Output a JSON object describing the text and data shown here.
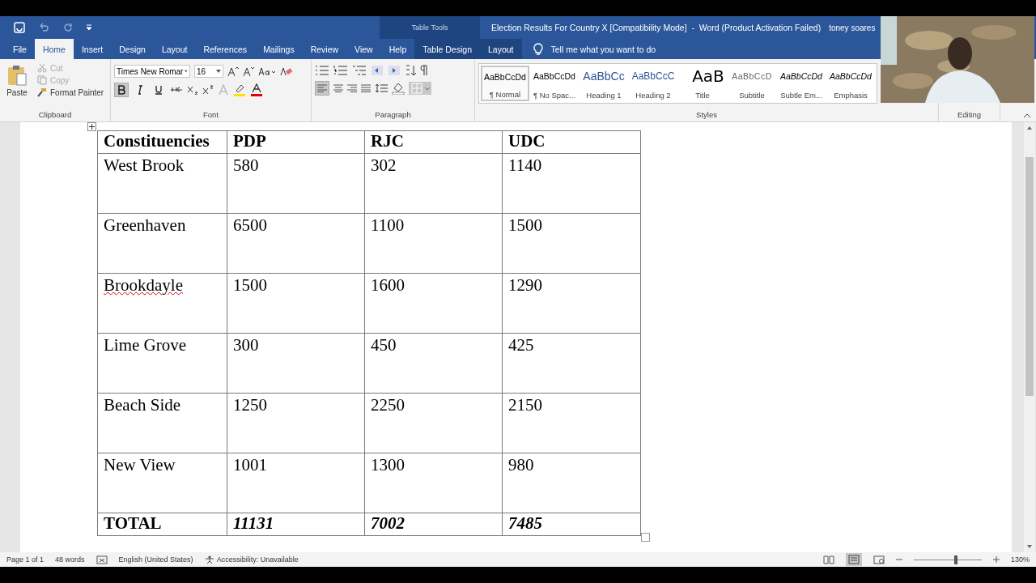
{
  "title_bar": {
    "context_label": "Table Tools",
    "title": "Election Results For Country X [Compatibility Mode]  -  Word (Product Activation Failed)",
    "user": "toney soares"
  },
  "tabs": [
    {
      "label": "File",
      "selected": false,
      "kind": "main"
    },
    {
      "label": "Home",
      "selected": true,
      "kind": "main"
    },
    {
      "label": "Insert",
      "selected": false,
      "kind": "main"
    },
    {
      "label": "Design",
      "selected": false,
      "kind": "main"
    },
    {
      "label": "Layout",
      "selected": false,
      "kind": "main"
    },
    {
      "label": "References",
      "selected": false,
      "kind": "main"
    },
    {
      "label": "Mailings",
      "selected": false,
      "kind": "main"
    },
    {
      "label": "Review",
      "selected": false,
      "kind": "main"
    },
    {
      "label": "View",
      "selected": false,
      "kind": "main"
    },
    {
      "label": "Help",
      "selected": false,
      "kind": "main"
    },
    {
      "label": "Table Design",
      "selected": false,
      "kind": "context"
    },
    {
      "label": "Layout",
      "selected": false,
      "kind": "context"
    }
  ],
  "tell_me": "Tell me what you want to do",
  "clipboard": {
    "label": "Clipboard",
    "paste": "Paste",
    "cut": {
      "label": "Cut",
      "disabled": true
    },
    "copy": {
      "label": "Copy",
      "disabled": true
    },
    "format_painter": "Format Painter"
  },
  "font": {
    "label": "Font",
    "name": "Times New Romar",
    "size": "16",
    "bold": true,
    "italic": false,
    "underline": false
  },
  "paragraph": {
    "label": "Paragraph",
    "align_left": true
  },
  "styles": {
    "label": "Styles",
    "items": [
      {
        "preview": "AaBbCcDd",
        "name": "¶ Normal",
        "selected": true,
        "kind": "normal"
      },
      {
        "preview": "AaBbCcDd",
        "name": "¶ No Spac...",
        "selected": false,
        "kind": "normal"
      },
      {
        "preview": "AaBbCc",
        "name": "Heading 1",
        "selected": false,
        "kind": "heading1"
      },
      {
        "preview": "AaBbCcC",
        "name": "Heading 2",
        "selected": false,
        "kind": "heading2"
      },
      {
        "preview": "AaB",
        "name": "Title",
        "selected": false,
        "kind": "title"
      },
      {
        "preview": "AaBbCcD",
        "name": "Subtitle",
        "selected": false,
        "kind": "subtitle"
      },
      {
        "preview": "AaBbCcDd",
        "name": "Subtle Em...",
        "selected": false,
        "kind": "italic"
      },
      {
        "preview": "AaBbCcDd",
        "name": "Emphasis",
        "selected": false,
        "kind": "italic"
      }
    ]
  },
  "editing": {
    "label": "Editing"
  },
  "table": {
    "columns": [
      "Constituencies",
      "PDP",
      "RJC",
      "UDC"
    ],
    "rows": [
      [
        "West Brook",
        "580",
        "302",
        "1140"
      ],
      [
        "Greenhaven",
        "6500",
        "1100",
        "1500"
      ],
      [
        "Brookdayle",
        "1500",
        "1600",
        "1290"
      ],
      [
        "Lime Grove",
        "300",
        "450",
        "425"
      ],
      [
        "Beach Side",
        "1250",
        "2250",
        "2150"
      ],
      [
        "New View",
        "1001",
        "1300",
        "980"
      ]
    ],
    "misspelled": [
      [
        false,
        false,
        false,
        false
      ],
      [
        false,
        false,
        false,
        false
      ],
      [
        true,
        false,
        false,
        false
      ],
      [
        false,
        false,
        false,
        false
      ],
      [
        false,
        false,
        false,
        false
      ],
      [
        false,
        false,
        false,
        false
      ]
    ],
    "total": [
      "TOTAL",
      "11131",
      "7002",
      "7485"
    ]
  },
  "status_bar": {
    "page": "Page 1 of 1",
    "words": "48 words",
    "language": "English (United States)",
    "accessibility": "Accessibility: Unavailable",
    "zoom": "130%",
    "zoom_slider": {
      "level": 0.6
    }
  }
}
